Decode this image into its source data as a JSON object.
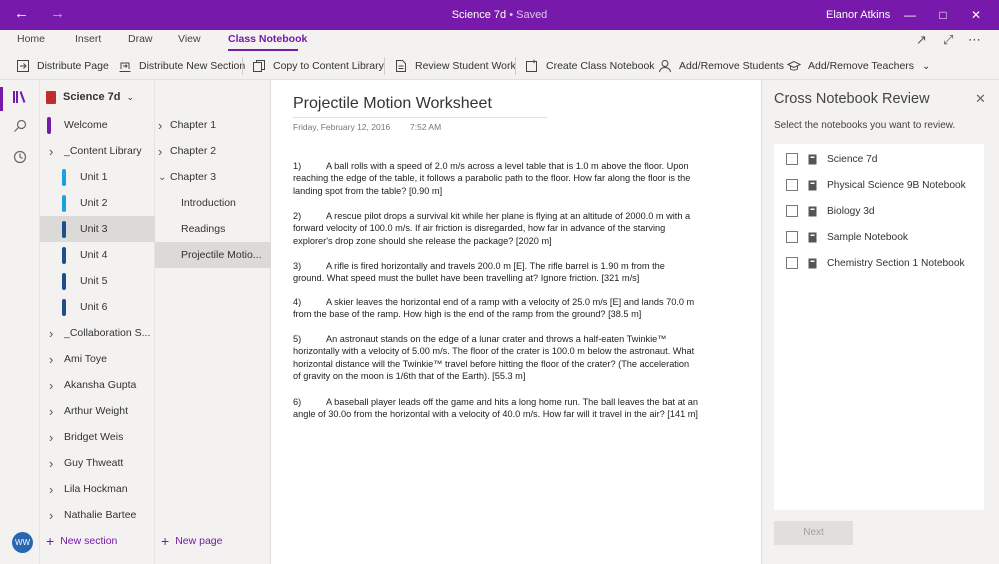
{
  "titlebar": {
    "title": "Science 7d",
    "separator": "•",
    "status": "Saved",
    "user": "Elanor Atkins"
  },
  "tabs": [
    "Home",
    "Insert",
    "Draw",
    "View",
    "Class Notebook"
  ],
  "active_tab": "Class Notebook",
  "ribbon": {
    "distribute_page": "Distribute Page",
    "distribute_section": "Distribute New Section",
    "copy_content": "Copy to Content Library",
    "review_work": "Review Student Work",
    "create_notebook": "Create Class Notebook",
    "add_students": "Add/Remove Students",
    "add_teachers": "Add/Remove Teachers"
  },
  "rail": {
    "avatar_initials": "WW"
  },
  "notebook": {
    "name": "Science 7d"
  },
  "sections": [
    {
      "label": "Welcome",
      "color": "#7719aa",
      "kind": "tab"
    },
    {
      "label": "_Content Library",
      "kind": "group"
    },
    {
      "label": "Unit 1",
      "color": "#1ba1e2",
      "kind": "tab"
    },
    {
      "label": "Unit 2",
      "color": "#1ba1e2",
      "kind": "tab"
    },
    {
      "label": "Unit 3",
      "color": "#1e4e8c",
      "kind": "tab",
      "selected": true
    },
    {
      "label": "Unit 4",
      "color": "#1e4e8c",
      "kind": "tab"
    },
    {
      "label": "Unit 5",
      "color": "#1e4e8c",
      "kind": "tab"
    },
    {
      "label": "Unit 6",
      "color": "#1e4e8c",
      "kind": "tab"
    },
    {
      "label": "_Collaboration S...",
      "kind": "group"
    },
    {
      "label": "Ami Toye",
      "kind": "group"
    },
    {
      "label": "Akansha Gupta",
      "kind": "group"
    },
    {
      "label": "Arthur Weight",
      "kind": "group"
    },
    {
      "label": "Bridget Weis",
      "kind": "group"
    },
    {
      "label": "Guy Thweatt",
      "kind": "group"
    },
    {
      "label": "Lila Hockman",
      "kind": "group"
    },
    {
      "label": "Nathalie Bartee",
      "kind": "group"
    }
  ],
  "new_section": "New section",
  "pages": [
    {
      "label": "Chapter 1",
      "kind": "collapsed"
    },
    {
      "label": "Chapter 2",
      "kind": "collapsed"
    },
    {
      "label": "Chapter 3",
      "kind": "expanded"
    },
    {
      "label": "Introduction",
      "kind": "sub"
    },
    {
      "label": "Readings",
      "kind": "sub"
    },
    {
      "label": "Projectile Motio...",
      "kind": "sub",
      "selected": true
    }
  ],
  "new_page": "New page",
  "page": {
    "title": "Projectile Motion Worksheet",
    "date": "Friday, February 12, 2016",
    "time": "7:52 AM",
    "questions": [
      {
        "num": "1)",
        "text": "A ball rolls with a speed of 2.0 m/s across a level table that is 1.0 m above the floor. Upon reaching the edge of the table, it follows a parabolic path to the floor. How far along the floor is the landing spot from the table? [0.90 m]"
      },
      {
        "num": "2)",
        "text": "A rescue pilot drops a survival kit while her plane is flying at an altitude of 2000.0 m with a forward velocity of 100.0 m/s. If air friction is disregarded, how far in advance of the starving explorer's drop zone should she release the package? [2020 m]"
      },
      {
        "num": "3)",
        "text": "A rifle is fired horizontally and travels 200.0 m [E]. The rifle barrel is 1.90 m from the ground. What speed must the bullet have been travelling at? Ignore friction.   [321 m/s]"
      },
      {
        "num": "4)",
        "text": "A skier leaves the horizontal end of a ramp with a velocity of 25.0 m/s [E] and lands 70.0 m from the base of the ramp. How high is the end of the ramp from the ground? [38.5 m]"
      },
      {
        "num": "5)",
        "text": "An astronaut stands on the edge of a lunar crater and throws a half-eaten Twinkie™ horizontally with a velocity of 5.00 m/s. The floor of the crater is 100.0 m below the astronaut. What horizontal distance will the Twinkie™ travel before hitting the floor of the crater? (The acceleration of gravity on the moon is 1/6th that of the Earth). [55.3 m]"
      },
      {
        "num": "6)",
        "text": "A baseball player leads off the game and hits a long home run. The ball leaves the bat at an angle of 30.0o from the horizontal with a velocity of 40.0 m/s. How far will it travel in the air? [141 m]"
      }
    ]
  },
  "panel": {
    "title": "Cross Notebook Review",
    "subtitle": "Select the notebooks you want to review.",
    "notebooks": [
      "Science 7d",
      "Physical Science 9B Notebook",
      "Biology 3d",
      "Sample Notebook",
      "Chemistry Section 1 Notebook"
    ],
    "next_label": "Next"
  },
  "colors": {
    "accent": "#7719aa",
    "notebook_red": "#c42b2b"
  }
}
